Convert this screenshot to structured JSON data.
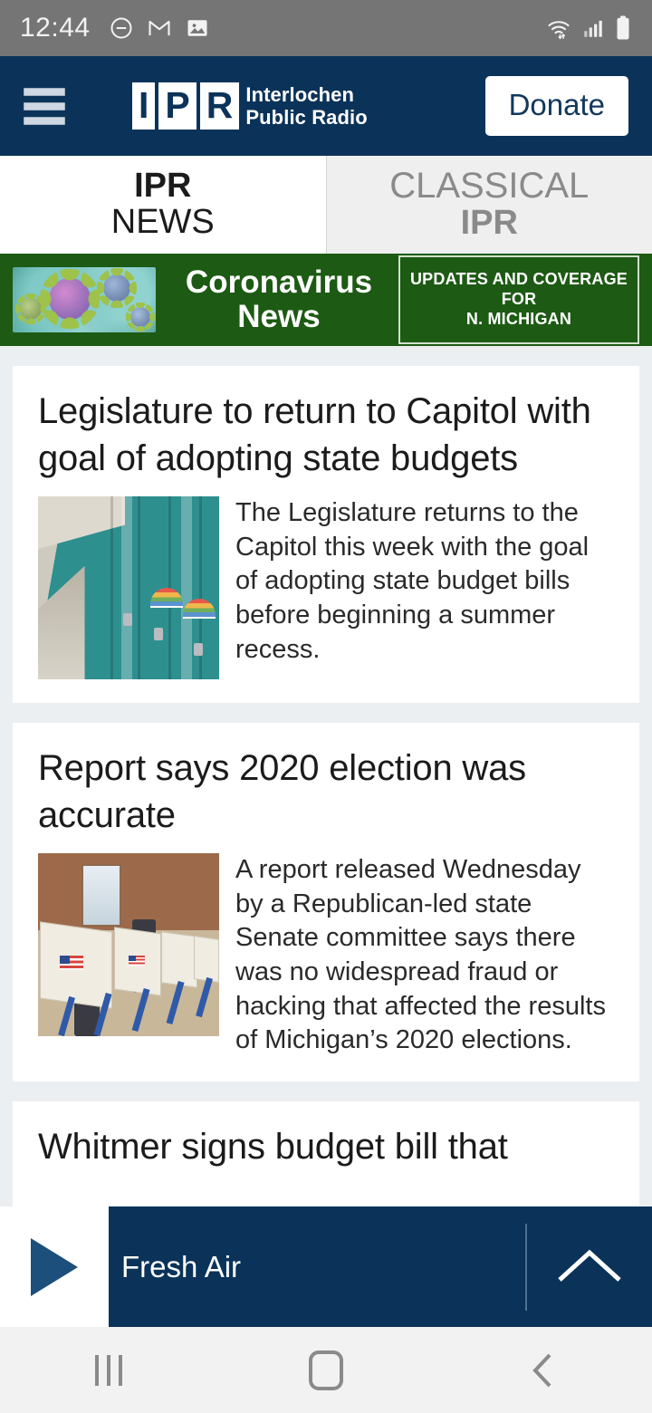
{
  "status_bar": {
    "time": "12:44",
    "left_icons": [
      "do-not-disturb-icon",
      "gmail-icon",
      "photos-icon"
    ],
    "right_icons": [
      "wifi-icon",
      "cellular-signal-icon",
      "battery-icon"
    ],
    "background": "#757575"
  },
  "header": {
    "menu_icon": "hamburger-menu-icon",
    "logo_letters": [
      "I",
      "P",
      "R"
    ],
    "logo_line1": "Interlochen",
    "logo_line2": "Public Radio",
    "donate_label": "Donate",
    "background": "#0b3359"
  },
  "tabs": [
    {
      "line1": "IPR",
      "line2": "NEWS",
      "active": true
    },
    {
      "line1": "CLASSICAL",
      "line2": "IPR",
      "active": false
    }
  ],
  "corona_banner": {
    "thumb_alt": "coronavirus-particles-image",
    "title_line1": "Coronavirus",
    "title_line2": "News",
    "cta_line1": "UPDATES AND COVERAGE FOR",
    "cta_line2": "N. MICHIGAN",
    "background": "#1d5a14"
  },
  "articles": [
    {
      "headline": "Legislature to return to Capitol with goal of adopting state budgets",
      "summary": "The Legislature returns to the Capitol this week with the goal of adopting state budget bills before beginning a summer recess.",
      "thumb_alt": "school-lockers-photo"
    },
    {
      "headline": "Report says 2020 election was accurate",
      "summary": "A report released Wednesday by a Republican-led state Senate committee says there was no widespread fraud or hacking that affected the results of Michigan’s 2020 elections.",
      "thumb_alt": "voting-booths-photo"
    },
    {
      "headline": "Whitmer signs budget bill that",
      "summary": "",
      "thumb_alt": ""
    }
  ],
  "player": {
    "play_icon": "play-icon",
    "now_playing": "Fresh Air",
    "expand_icon": "chevron-up-icon",
    "background": "#0b3359"
  },
  "nav_bar": {
    "recents_label": "recents-icon",
    "home_label": "home-icon",
    "back_label": "back-icon",
    "background": "#f2f2f2"
  }
}
